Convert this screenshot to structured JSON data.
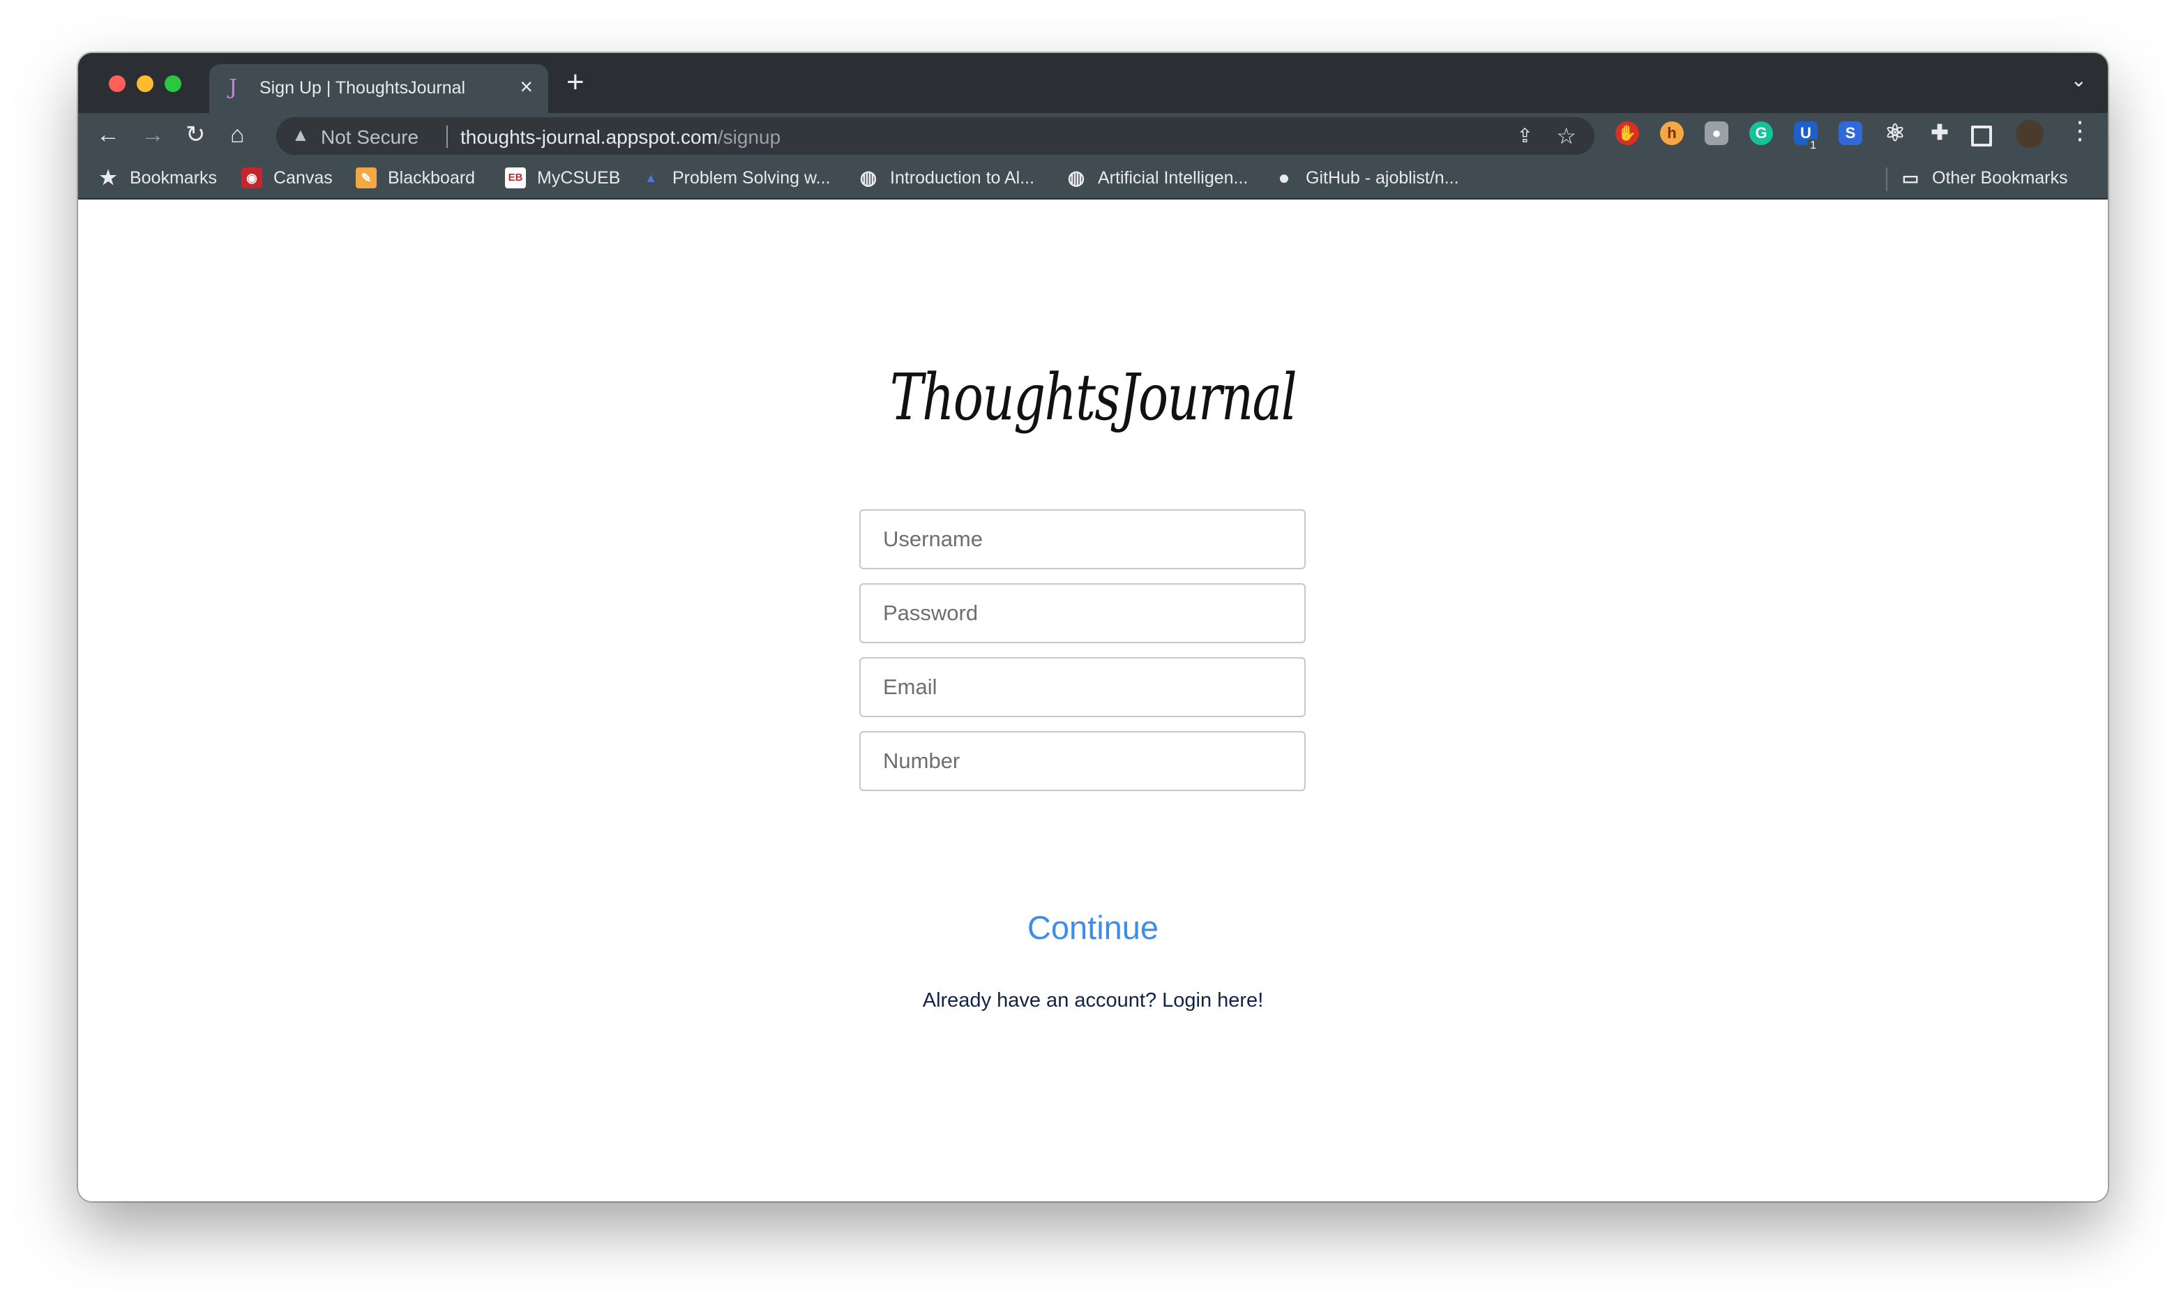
{
  "browser": {
    "tab_title": "Sign Up | ThoughtsJournal",
    "tab_favicon": "J",
    "security_label": "Not Secure",
    "url_host": "thoughts-journal.appspot.com",
    "url_path": "/signup",
    "extension_badge": "1"
  },
  "bookmarks": [
    {
      "label": "Bookmarks",
      "icon": "star-icon"
    },
    {
      "label": "Canvas",
      "icon": "canvas-icon"
    },
    {
      "label": "Blackboard",
      "icon": "blackboard-icon"
    },
    {
      "label": "MyCSUEB",
      "icon": "mycsueb-icon"
    },
    {
      "label": "Problem Solving w...",
      "icon": "problem-solving-icon"
    },
    {
      "label": "Introduction to Al...",
      "icon": "globe-icon"
    },
    {
      "label": "Artificial Intelligen...",
      "icon": "globe-icon"
    },
    {
      "label": "GitHub - ajoblist/n...",
      "icon": "github-icon"
    },
    {
      "label": "Other Bookmarks",
      "icon": "folder-icon"
    }
  ],
  "page": {
    "logo": "ThoughtsJournal",
    "username_placeholder": "Username",
    "password_placeholder": "Password",
    "email_placeholder": "Email",
    "number_placeholder": "Number",
    "continue_label": "Continue",
    "login_link": "Already have an account? Login here!"
  },
  "colors": {
    "accent": "#3d8eea",
    "link": "#0f2346",
    "chrome": "#414b52"
  }
}
